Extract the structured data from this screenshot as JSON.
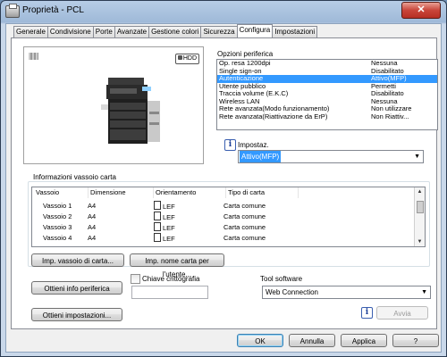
{
  "window": {
    "title": "Proprietà - PCL",
    "close_label": "✕"
  },
  "tabs": [
    "Generale",
    "Condivisione",
    "Porte",
    "Avanzate",
    "Gestione colori",
    "Sicurezza",
    "Configura",
    "Impostazioni"
  ],
  "active_tab": "Configura",
  "preview": {
    "hdd_badge": "HDD"
  },
  "device_options": {
    "label": "Opzioni periferica",
    "rows": [
      {
        "name": "Op. resa 1200dpi",
        "value": "Nessuna"
      },
      {
        "name": "Single sign-on",
        "value": "Disabilitato"
      },
      {
        "name": "Autenticazione",
        "value": "Attivo(MFP)"
      },
      {
        "name": "Utente pubblico",
        "value": "Permetti"
      },
      {
        "name": "Traccia volume (E.K.C)",
        "value": "Disabilitato"
      },
      {
        "name": "Wireless LAN",
        "value": "Nessuna"
      },
      {
        "name": "Rete avanzata(Modo funzionamento)",
        "value": "Non utilizzare"
      },
      {
        "name": "Rete avanzata(Riattivazione da ErP)",
        "value": "Non Riattiv..."
      }
    ],
    "selected_index": 2,
    "setting_label": "Impostaz.",
    "setting_value": "Attivo(MFP)"
  },
  "tray_info": {
    "label": "Informazioni vassoio carta",
    "columns": [
      "Vassoio",
      "Dimensione",
      "Orientamento",
      "Tipo di carta"
    ],
    "rows": [
      {
        "tray": "Vassoio 1",
        "size": "A4",
        "orientation": "LEF",
        "type": "Carta comune"
      },
      {
        "tray": "Vassoio 2",
        "size": "A4",
        "orientation": "LEF",
        "type": "Carta comune"
      },
      {
        "tray": "Vassoio 3",
        "size": "A4",
        "orientation": "LEF",
        "type": "Carta comune"
      },
      {
        "tray": "Vassoio 4",
        "size": "A4",
        "orientation": "LEF",
        "type": "Carta comune"
      }
    ],
    "btn_tray_settings": "Imp. vassoio di carta...",
    "btn_paper_name": "Imp. nome carta per l'utente..."
  },
  "actions": {
    "get_device_info": "Ottieni info periferica",
    "encryption_key": "Chiave crittografia",
    "get_settings": "Ottieni impostazioni...",
    "tool_software_label": "Tool software",
    "tool_software_value": "Web Connection",
    "start": "Avvia"
  },
  "footer": {
    "ok": "OK",
    "cancel": "Annulla",
    "apply": "Applica",
    "help": "?"
  }
}
